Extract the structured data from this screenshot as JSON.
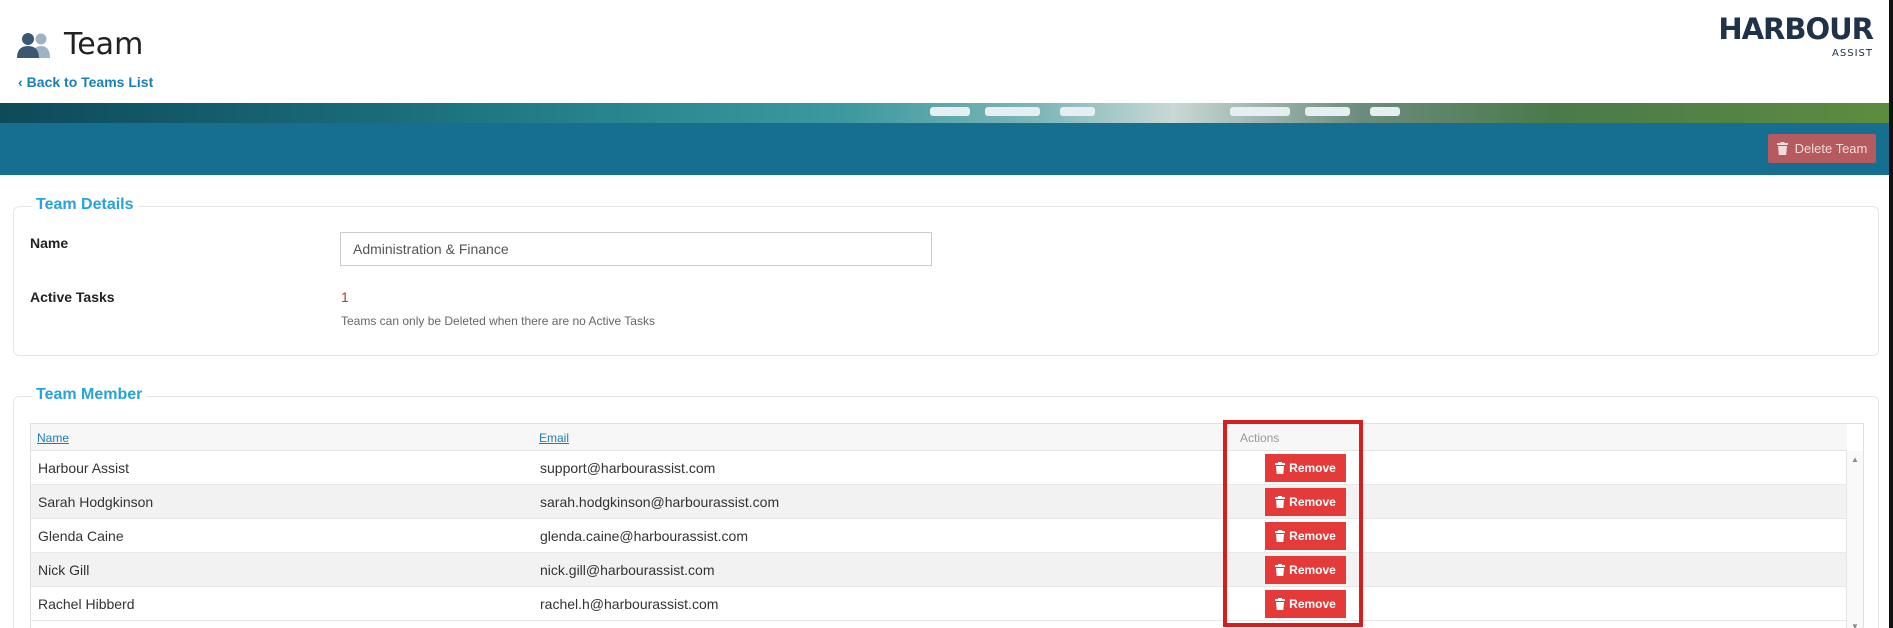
{
  "header": {
    "title": "Team",
    "back_link": "Back to Teams List",
    "logo_main": "HARBOUR",
    "logo_sub": "ASSIST"
  },
  "action_bar": {
    "delete_label": "Delete Team",
    "delete_color": "#b55a5f",
    "bar_color": "#166f91"
  },
  "details": {
    "legend": "Team Details",
    "name_label": "Name",
    "name_value": "Administration & Finance",
    "active_label": "Active Tasks",
    "active_value": "1",
    "active_note": "Teams can only be Deleted when there are no Active Tasks"
  },
  "members": {
    "legend": "Team Member",
    "columns": {
      "name": "Name",
      "email": "Email",
      "actions": "Actions"
    },
    "remove_label": "Remove",
    "rows": [
      {
        "name": "Harbour Assist",
        "email": "support@harbourassist.com"
      },
      {
        "name": "Sarah Hodgkinson",
        "email": "sarah.hodgkinson@harbourassist.com"
      },
      {
        "name": "Glenda Caine",
        "email": "glenda.caine@harbourassist.com"
      },
      {
        "name": "Nick Gill",
        "email": "nick.gill@harbourassist.com"
      },
      {
        "name": "Rachel Hibberd",
        "email": "rachel.h@harbourassist.com"
      }
    ]
  },
  "colors": {
    "accent": "#27a3d8",
    "remove": "#e53a3a",
    "highlight": "#d81d1d"
  }
}
